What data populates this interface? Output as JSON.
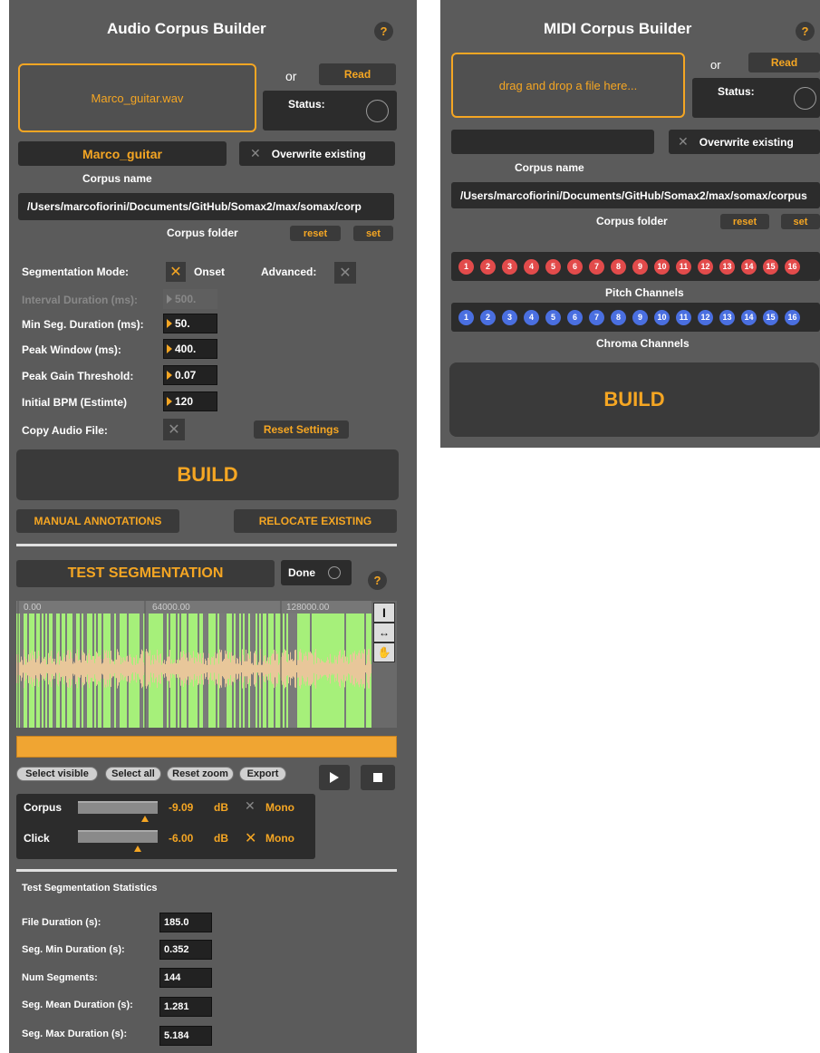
{
  "audio": {
    "title": "Audio Corpus Builder",
    "help": "?",
    "dropfile": "Marco_guitar.wav",
    "or": "or",
    "read": "Read",
    "status": "Status:",
    "corpus_name_value": "Marco_guitar",
    "overwrite": "Overwrite existing",
    "corpus_name_label": "Corpus name",
    "folder_path": "/Users/marcofiorini/Documents/GitHub/Somax2/max/somax/corp",
    "corpus_folder": "Corpus folder",
    "reset": "reset",
    "set": "set",
    "seg_mode_label": "Segmentation Mode:",
    "seg_mode_value": "Onset",
    "advanced": "Advanced:",
    "params": [
      {
        "label": "Interval Duration (ms):",
        "value": "500.",
        "disabled": true
      },
      {
        "label": "Min Seg. Duration (ms):",
        "value": "50."
      },
      {
        "label": "Peak Window (ms):",
        "value": "400."
      },
      {
        "label": "Peak Gain Threshold:",
        "value": "0.07"
      },
      {
        "label": "Initial BPM (Estimte)",
        "value": "120"
      }
    ],
    "copy_audio": "Copy Audio File:",
    "reset_settings": "Reset Settings",
    "build": "BUILD",
    "manual_annotations": "MANUAL ANNOTATIONS",
    "relocate_existing": "RELOCATE EXISTING",
    "test_segmentation": "TEST SEGMENTATION",
    "done": "Done",
    "ruler": [
      "0.00",
      "64000.00",
      "128000.00"
    ],
    "waveform_color": "#a6f07a",
    "wave_bg_color": "#e8c79a",
    "buttons": {
      "select_visible": "Select visible",
      "select_all": "Select all",
      "reset_zoom": "Reset zoom",
      "export": "Export"
    },
    "mixer": [
      {
        "name": "Corpus",
        "value": "-9.09",
        "unit": "dB",
        "mono": "Mono",
        "mono_on": false
      },
      {
        "name": "Click",
        "value": "-6.00",
        "unit": "dB",
        "mono": "Mono",
        "mono_on": true
      }
    ],
    "stats_title": "Test Segmentation Statistics",
    "stats": [
      {
        "label": "File Duration (s):",
        "value": "185.0"
      },
      {
        "label": "Seg. Min Duration (s):",
        "value": "0.352"
      },
      {
        "label": "Num Segments:",
        "value": "144"
      },
      {
        "label": "Seg. Mean Duration (s):",
        "value": "1.281"
      },
      {
        "label": "Seg. Max Duration (s):",
        "value": "5.184"
      }
    ]
  },
  "midi": {
    "title": "MIDI Corpus Builder",
    "help": "?",
    "drop_placeholder": "drag and drop a file here...",
    "or": "or",
    "read": "Read",
    "status": "Status:",
    "overwrite": "Overwrite existing",
    "corpus_name_label": "Corpus name",
    "folder_path": "/Users/marcofiorini/Documents/GitHub/Somax2/max/somax/corpus",
    "corpus_folder": "Corpus folder",
    "reset": "reset",
    "set": "set",
    "pitch_channels_label": "Pitch Channels",
    "chroma_channels_label": "Chroma Channels",
    "channels": [
      "1",
      "2",
      "3",
      "4",
      "5",
      "6",
      "7",
      "8",
      "9",
      "10",
      "11",
      "12",
      "13",
      "14",
      "15",
      "16"
    ],
    "pitch_color": "#e24b4b",
    "chroma_color": "#4a6fe0",
    "build": "BUILD"
  }
}
